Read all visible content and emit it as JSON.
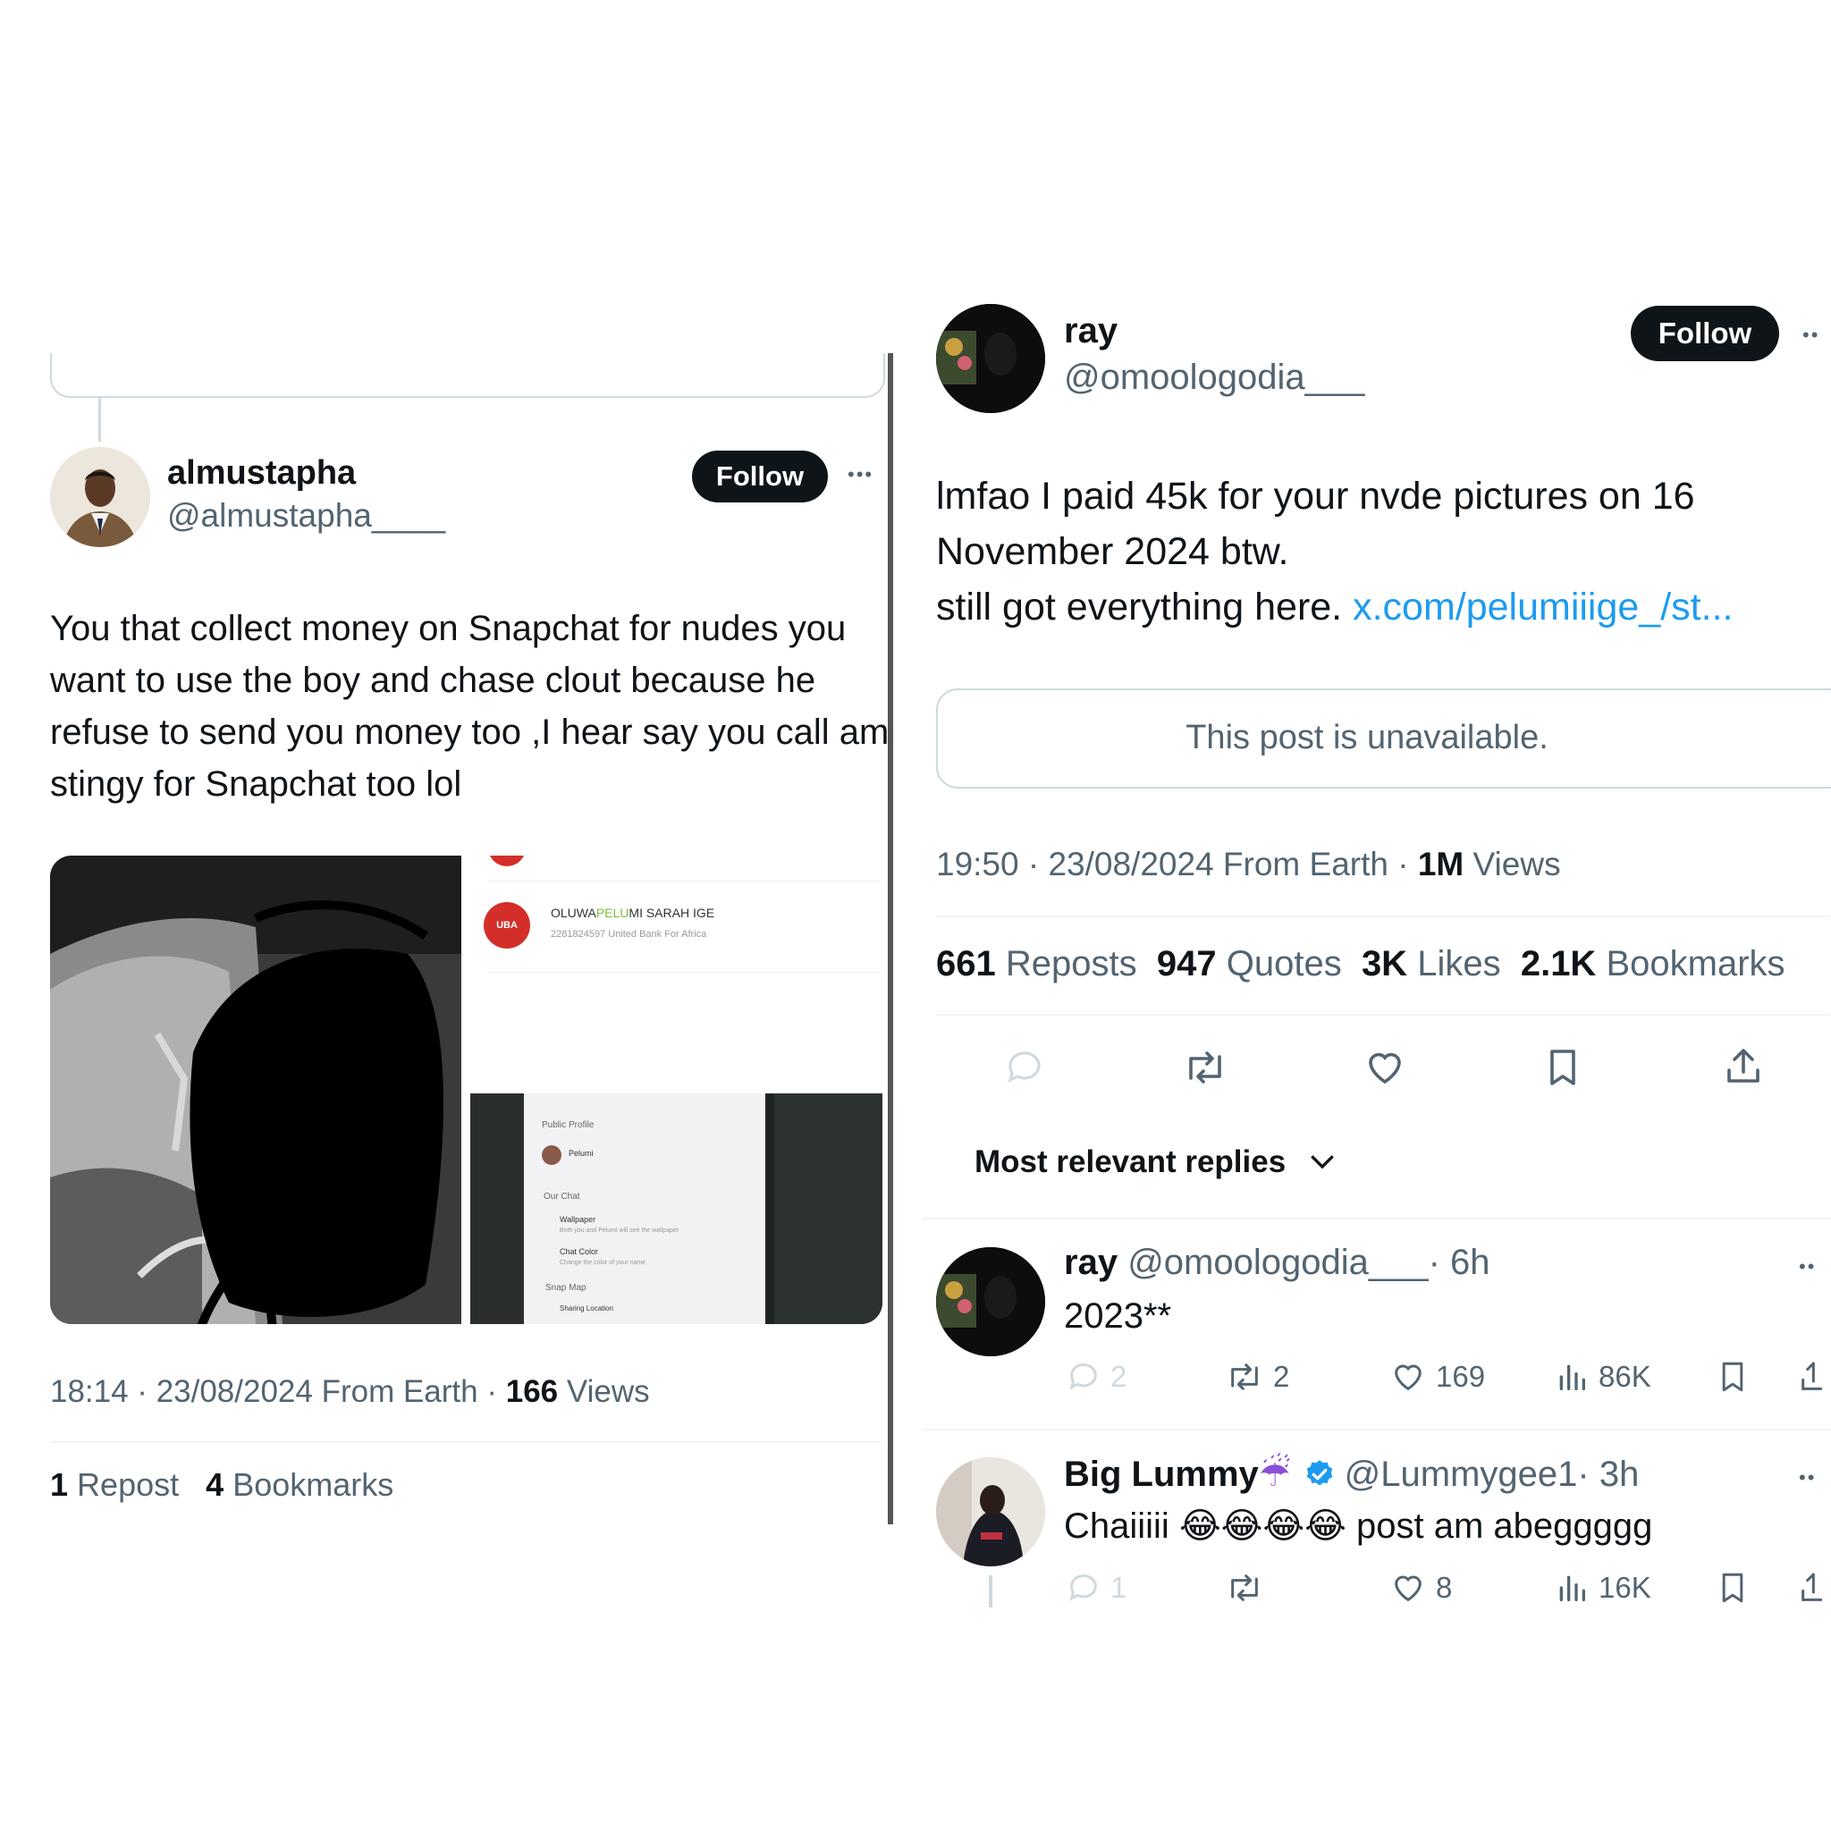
{
  "left": {
    "author": {
      "name": "almustapha",
      "handle": "@almustapha____"
    },
    "follow_label": "Follow",
    "more_label": "•••",
    "body": "You that collect money on Snapchat for nudes you want to use the boy and chase clout because he refuse to send you money too ,I hear say you call am stingy for Snapchat too lol",
    "media": {
      "bank_logo": "UBA",
      "account_name_a": "OLUWA",
      "account_name_b": "PELU",
      "account_name_c": "MI SARAH IGE",
      "account_detail": "2281824597  United Bank For Africa",
      "phone_public_profile": "Public Profile",
      "phone_profile_name": "Pelumi",
      "phone_our_chat": "Our Chat",
      "phone_wallpaper": "Wallpaper",
      "phone_wallpaper_sub": "Both you and Pelumi will see the wallpaper",
      "phone_chat_color": "Chat Color",
      "phone_chat_color_sub": "Change the color of your name",
      "phone_snap_map": "Snap Map",
      "phone_sharing_location": "Sharing Location"
    },
    "meta": {
      "time": "18:14 · 23/08/2024 From Earth · ",
      "views_num": "166",
      "views_label": " Views"
    },
    "stats": {
      "reposts_num": "1",
      "reposts_label": "Repost",
      "bookmarks_num": "4",
      "bookmarks_label": "Bookmarks"
    }
  },
  "right": {
    "author": {
      "name": "ray",
      "handle": "@omoologodia___"
    },
    "follow_label": "Follow",
    "body_line1": "lmfao I paid 45k for your nvde pictures on 16 November 2024 btw.",
    "body_line2": "still got everything here. ",
    "body_link": "x.com/pelumiiige_/st...",
    "unavailable": "This post is unavailable.",
    "meta": {
      "time": "19:50 · 23/08/2024 From Earth · ",
      "views_num": "1M",
      "views_label": " Views"
    },
    "stats": {
      "reposts_num": "661",
      "reposts_label": "Reposts",
      "quotes_num": "947",
      "quotes_label": "Quotes",
      "likes_num": "3K",
      "likes_label": "Likes",
      "bookmarks_num": "2.1K",
      "bookmarks_label": "Bookmarks"
    },
    "sort_label": "Most relevant replies",
    "replies": [
      {
        "name": "ray",
        "handle": "@omoologodia___",
        "time": "· 6h",
        "text": "2023**",
        "replies": "2",
        "reposts": "2",
        "likes": "169",
        "views": "86K"
      },
      {
        "name": "Big Lummy",
        "emoji": "☔",
        "handle": "@Lummygee1",
        "time": "· 3h",
        "text_a": "Chaiiiii ",
        "text_emoji": "😂😂😂😂",
        "text_b": " post am abeggggg",
        "replies": "1",
        "reposts": "",
        "likes": "8",
        "views": "16K"
      }
    ]
  },
  "colors": {
    "link": "#1d9bf0",
    "muted": "#536471",
    "text": "#0f1419",
    "verified": "#1d9bf0",
    "uba": "#d42e2a"
  }
}
